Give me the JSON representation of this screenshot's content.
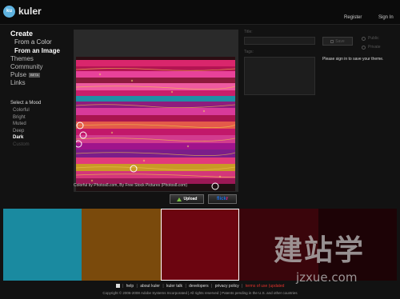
{
  "header": {
    "logo_badge": "ku",
    "logo_text": "kuler",
    "register": "Register",
    "sign_in": "Sign In"
  },
  "nav": {
    "create": "Create",
    "from_color": "From a Color",
    "from_image": "From an Image",
    "themes": "Themes",
    "community": "Community",
    "pulse": "Pulse",
    "pulse_badge": "BETA",
    "links": "Links"
  },
  "mood": {
    "title": "Select a Mood",
    "options": [
      "Colorful",
      "Bright",
      "Muted",
      "Deep",
      "Dark",
      "Custom"
    ],
    "selected": "Dark"
  },
  "image": {
    "caption": "Colorful by Photos8.com, By Free Stock Pictures (Photos8.com)"
  },
  "buttons": {
    "upload": "Upload",
    "flickr_a": "flick",
    "flickr_b": "r"
  },
  "form": {
    "title_label": "Title:",
    "tags_label": "Tags:",
    "save": "Save",
    "public": "Public",
    "private": "Private",
    "signin_msg": "Please sign in to save your theme."
  },
  "swatches": [
    "#1a8aa0",
    "#7a4a0c",
    "#6c0510",
    "#3a050b",
    "#1d0306"
  ],
  "footer": {
    "links": [
      "help",
      "about kuler",
      "kuler talk",
      "developers",
      "privacy policy",
      "terms of use (updated"
    ],
    "copyright": "Copyright © 2006-2008 Adobe Systems Incorporated | All rights reserved | Patents pending in the U.S. and other countries"
  },
  "watermark": {
    "cn": "建站学",
    "url": "jzxue.com"
  }
}
